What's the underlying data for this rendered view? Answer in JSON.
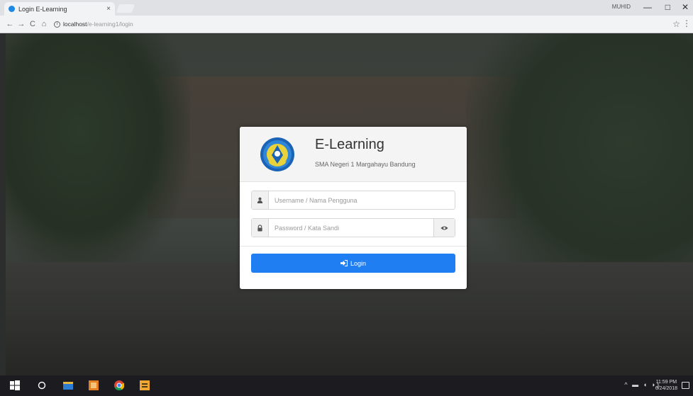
{
  "browser": {
    "tab_title": "Login E-Learning",
    "tab_close": "×",
    "address": "localhost",
    "address_path": "/e-learning1/login",
    "window_user": "MUHID",
    "minimize": "—",
    "maximize": "□",
    "close": "✕",
    "back": "←",
    "forward": "→",
    "reload": "C",
    "home": "⌂",
    "star": "☆",
    "menu": "⋮"
  },
  "login": {
    "app_title": "E-Learning",
    "school_name": "SMA Negeri 1 Margahayu Bandung",
    "username_placeholder": "Username / Nama Pengguna",
    "password_placeholder": "Password / Kata Sandi",
    "login_label": "Login",
    "icons": {
      "username": "user-icon",
      "password": "lock-icon",
      "toggle": "eye-icon",
      "login": "sign-in-icon"
    }
  },
  "taskbar": {
    "time": "11:59 PM",
    "date": "6/24/2018",
    "tray": "^ ▬ ◖ ◗)"
  },
  "colors": {
    "primary": "#1e7ef2",
    "taskbar": "#1b1b20",
    "tab_favicon": "#1e88e5"
  }
}
